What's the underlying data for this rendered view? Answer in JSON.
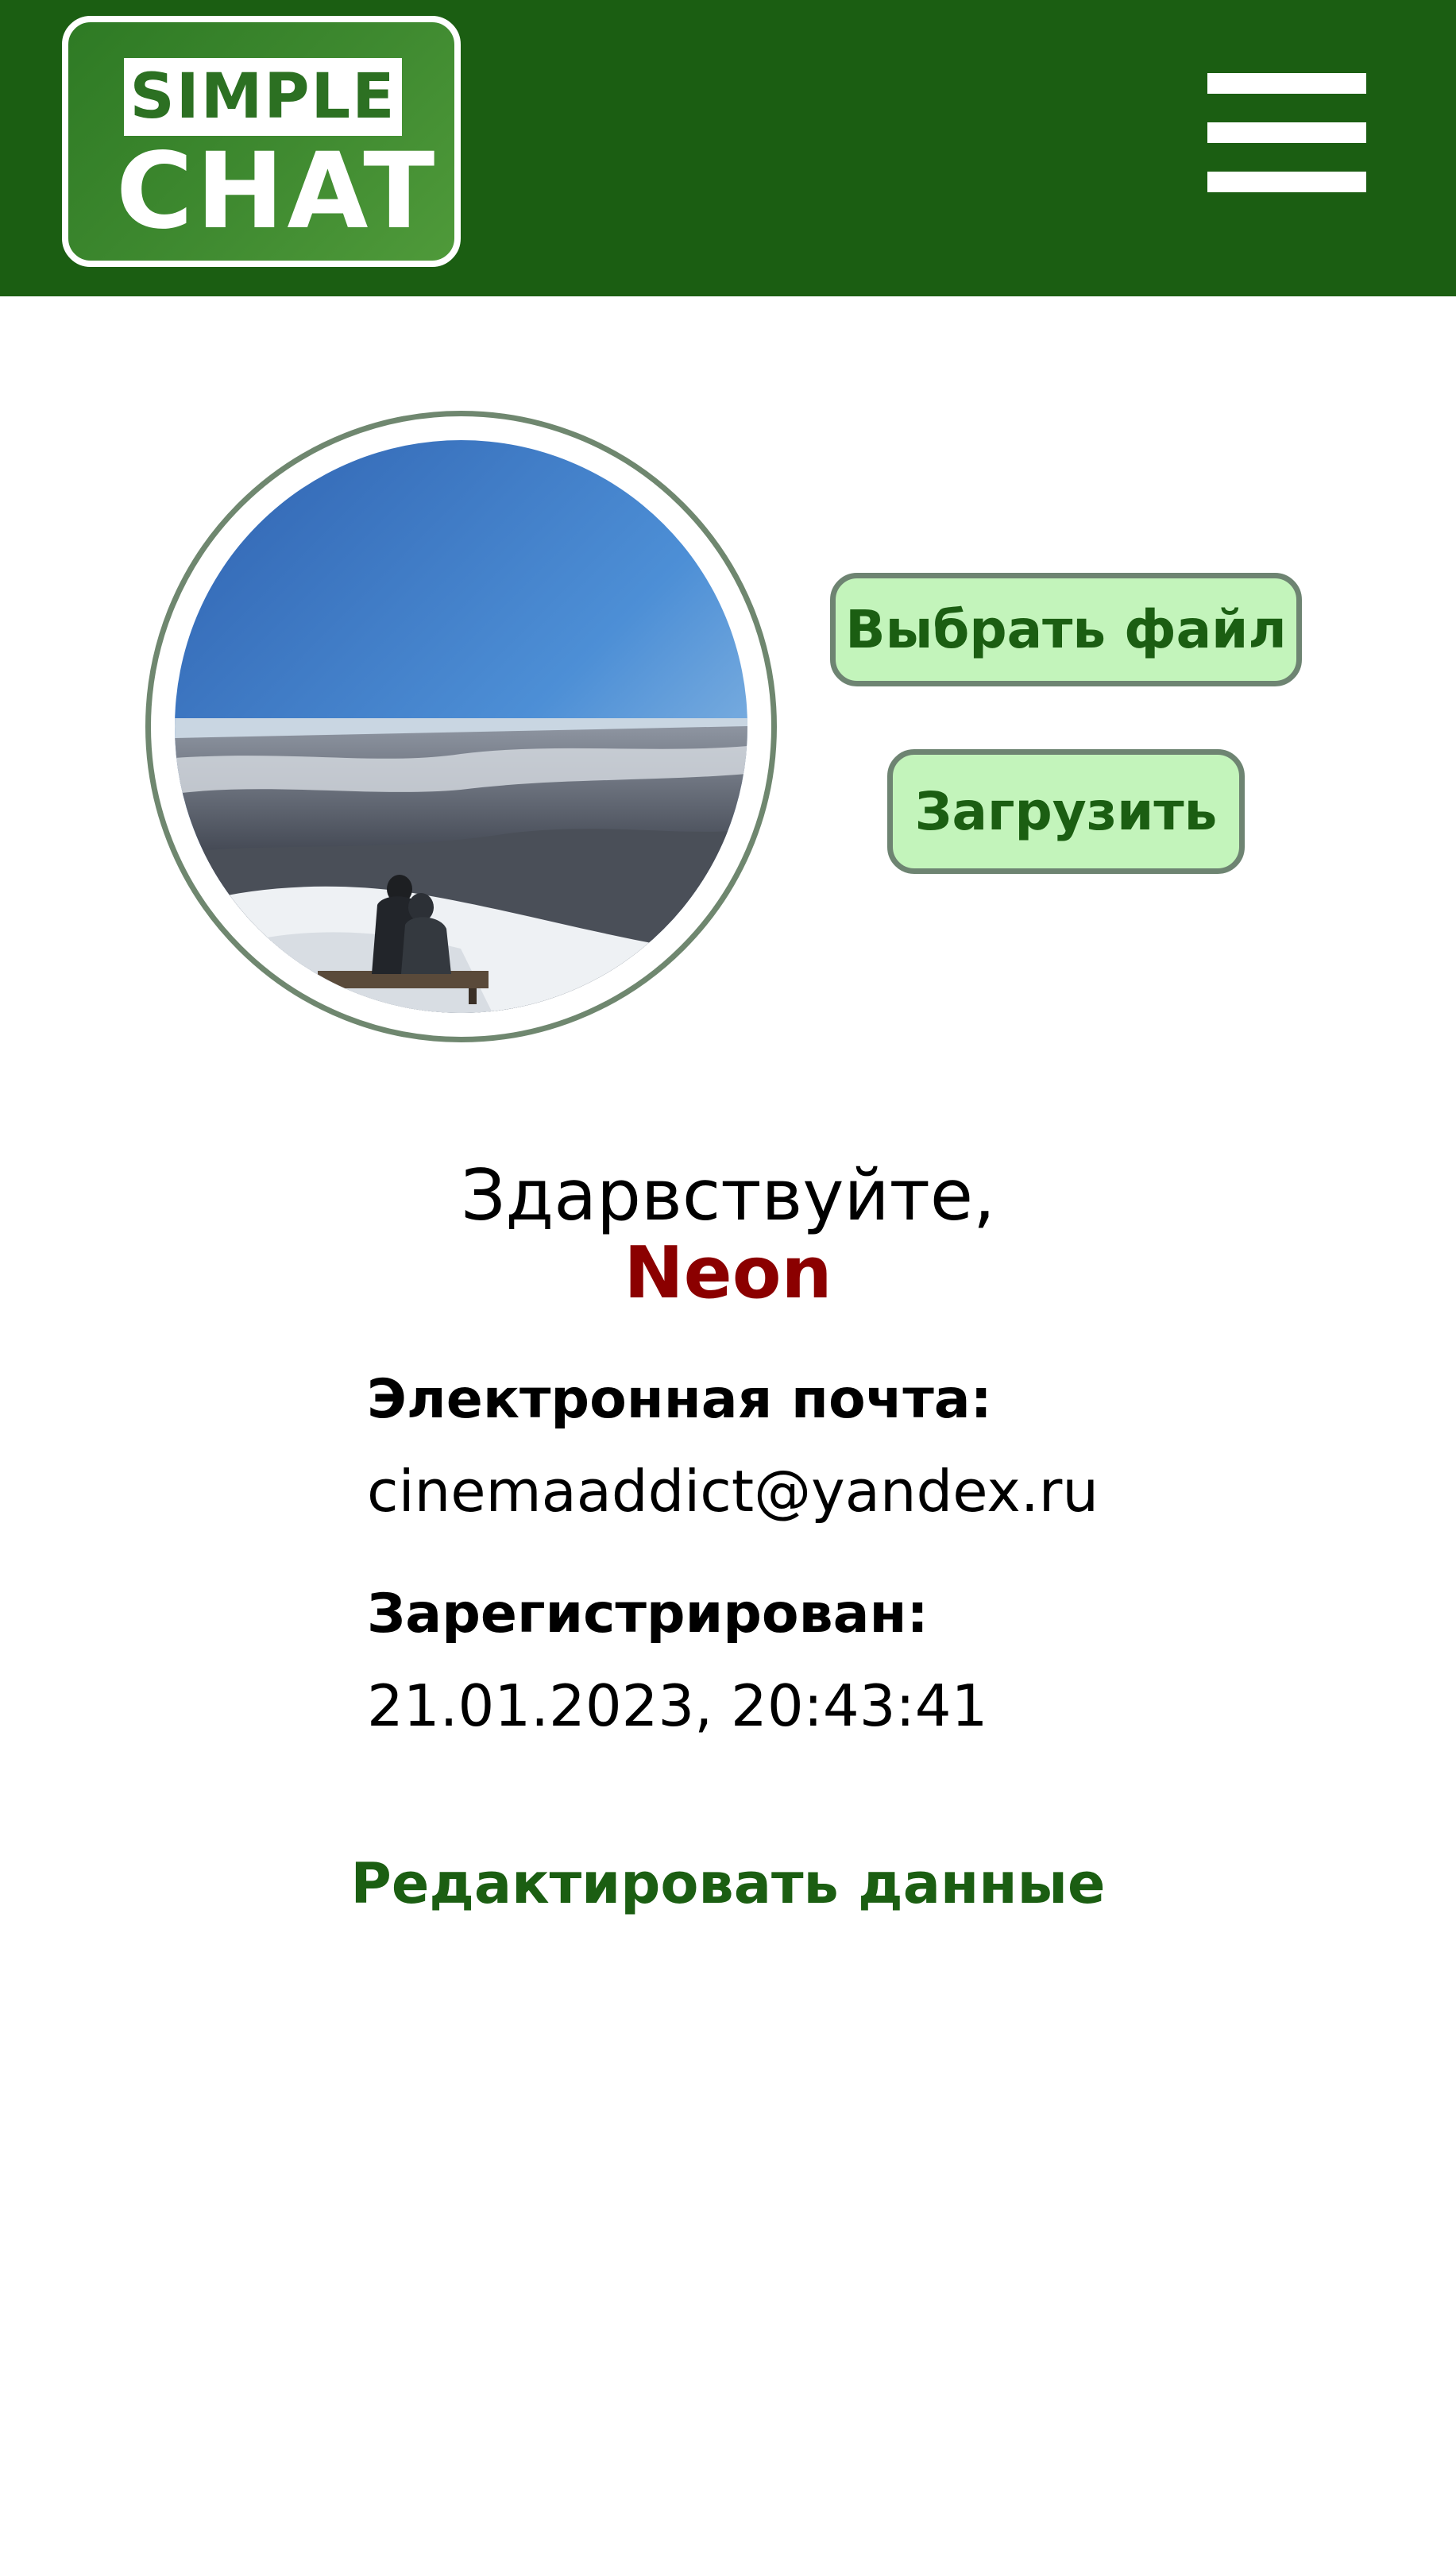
{
  "header": {
    "logo": {
      "line1": "SIMPLE",
      "line2": "CHAT"
    },
    "menu_icon": "hamburger-menu-icon",
    "background_color": "#1b5e12"
  },
  "profile": {
    "avatar": {
      "image": "photo: two people sitting on a bench on a snowy hill overlooking a city under a blue sky"
    },
    "buttons": {
      "choose_file": "Выбрать файл",
      "upload": "Загрузить"
    },
    "greeting": "Здарвствуйте,",
    "username": "Neon",
    "email_label": "Электронная почта:",
    "email_value": "cinemaaddict@yandex.ru",
    "registered_label": "Зарегистрирован:",
    "registered_value": "21.01.2023, 20:43:41",
    "edit_link": "Редактировать данные"
  },
  "colors": {
    "primary_green": "#1b5e12",
    "button_fill": "#c3f4bb",
    "button_border": "#6e8472",
    "username_red": "#8b0000"
  }
}
